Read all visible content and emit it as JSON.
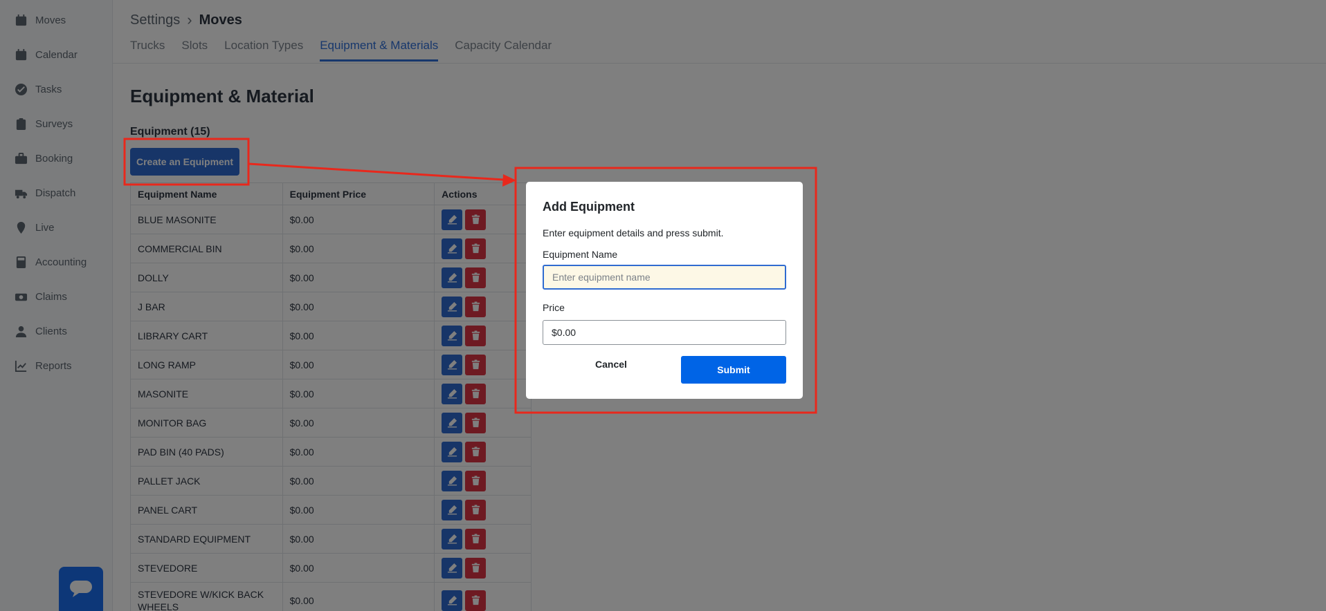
{
  "sidebar": {
    "items": [
      {
        "label": "Moves",
        "icon": "calendar-check-icon"
      },
      {
        "label": "Calendar",
        "icon": "calendar-icon"
      },
      {
        "label": "Tasks",
        "icon": "check-circle-icon"
      },
      {
        "label": "Surveys",
        "icon": "clipboard-icon"
      },
      {
        "label": "Booking",
        "icon": "briefcase-icon"
      },
      {
        "label": "Dispatch",
        "icon": "truck-icon"
      },
      {
        "label": "Live",
        "icon": "map-pin-icon"
      },
      {
        "label": "Accounting",
        "icon": "calculator-icon"
      },
      {
        "label": "Claims",
        "icon": "money-icon"
      },
      {
        "label": "Clients",
        "icon": "user-icon"
      },
      {
        "label": "Reports",
        "icon": "chart-line-icon"
      }
    ]
  },
  "header": {
    "breadcrumb_root": "Settings",
    "breadcrumb_sep": "›",
    "breadcrumb_current": "Moves",
    "tabs": [
      {
        "label": "Trucks",
        "active": false
      },
      {
        "label": "Slots",
        "active": false
      },
      {
        "label": "Location Types",
        "active": false
      },
      {
        "label": "Equipment & Materials",
        "active": true
      },
      {
        "label": "Capacity Calendar",
        "active": false
      }
    ]
  },
  "main": {
    "title": "Equipment & Material",
    "section_title": "Equipment (15)",
    "create_button": "Create an Equipment",
    "table": {
      "headers": [
        "Equipment Name",
        "Equipment Price",
        "Actions"
      ],
      "rows": [
        [
          "BLUE MASONITE",
          "$0.00"
        ],
        [
          "COMMERCIAL BIN",
          "$0.00"
        ],
        [
          "DOLLY",
          "$0.00"
        ],
        [
          "J BAR",
          "$0.00"
        ],
        [
          "LIBRARY CART",
          "$0.00"
        ],
        [
          "LONG RAMP",
          "$0.00"
        ],
        [
          "MASONITE",
          "$0.00"
        ],
        [
          "MONITOR BAG",
          "$0.00"
        ],
        [
          "PAD BIN (40 PADS)",
          "$0.00"
        ],
        [
          "PALLET JACK",
          "$0.00"
        ],
        [
          "PANEL CART",
          "$0.00"
        ],
        [
          "STANDARD EQUIPMENT",
          "$0.00"
        ],
        [
          "STEVEDORE",
          "$0.00"
        ],
        [
          "STEVEDORE W/KICK BACK WHEELS",
          "$0.00"
        ]
      ]
    }
  },
  "modal": {
    "title": "Add Equipment",
    "description": "Enter equipment details and press submit.",
    "name_label": "Equipment Name",
    "name_placeholder": "Enter equipment name",
    "name_value": "",
    "price_label": "Price",
    "price_value": "$0.00",
    "cancel_label": "Cancel",
    "submit_label": "Submit"
  },
  "colors": {
    "accent": "#2f6bd0",
    "danger": "#dc3545",
    "submit": "#0064e6",
    "annotation": "#e8281c"
  }
}
